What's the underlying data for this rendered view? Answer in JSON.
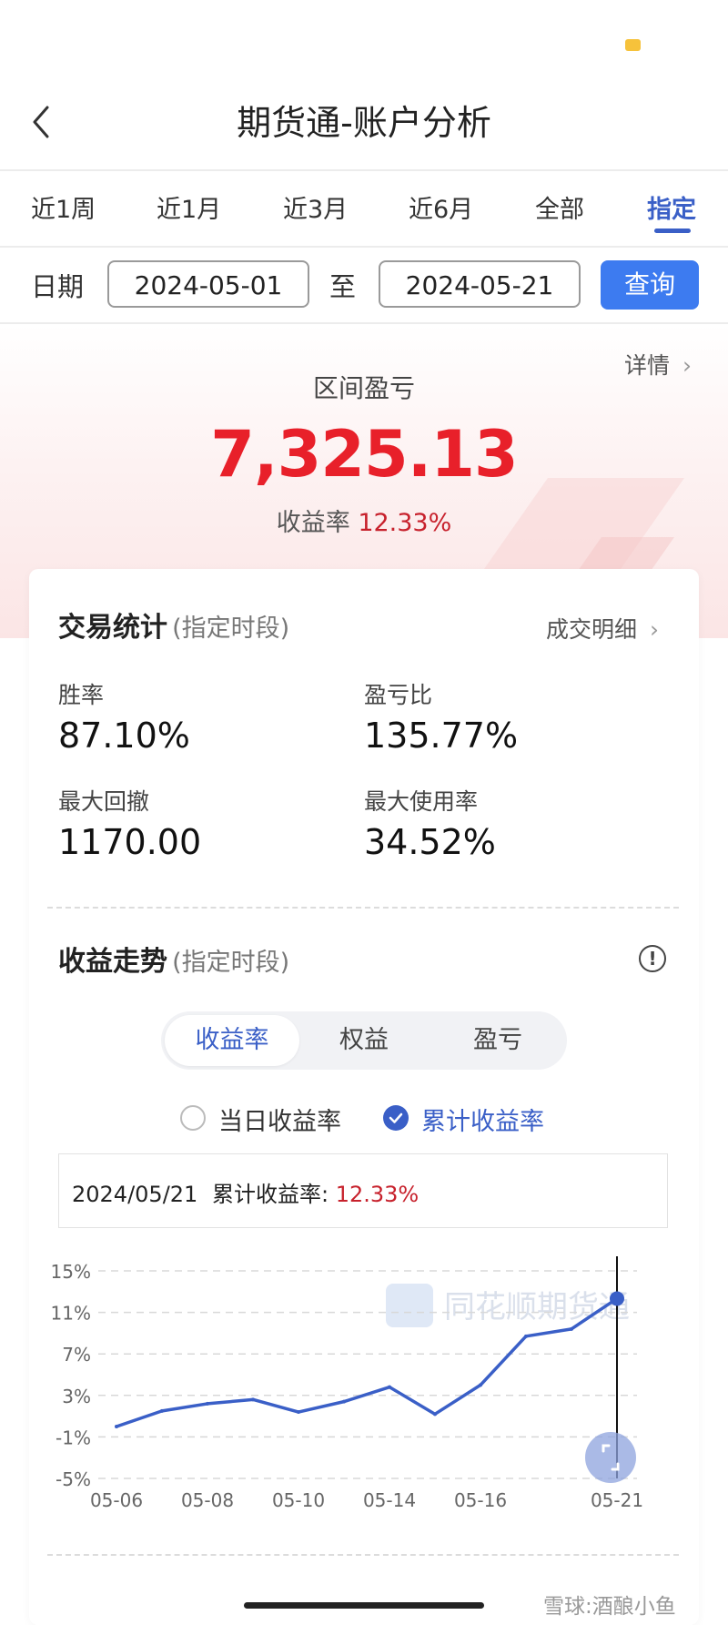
{
  "header": {
    "title": "期货通-账户分析"
  },
  "tabs": [
    {
      "label": "近1周"
    },
    {
      "label": "近1月"
    },
    {
      "label": "近3月"
    },
    {
      "label": "近6月"
    },
    {
      "label": "全部"
    },
    {
      "label": "指定",
      "active": true
    }
  ],
  "date_filter": {
    "label": "日期",
    "start": "2024-05-01",
    "separator": "至",
    "end": "2024-05-21",
    "query_label": "查询"
  },
  "summary": {
    "detail_link": "详情",
    "range_label": "区间盈亏",
    "pnl": "7,325.13",
    "yield_label": "收益率",
    "yield_value": "12.33%"
  },
  "trade_stats": {
    "title": "交易统计",
    "subtitle": "(指定时段)",
    "link": "成交明细",
    "items": [
      {
        "label": "胜率",
        "value": "87.10%"
      },
      {
        "label": "盈亏比",
        "value": "135.77%"
      },
      {
        "label": "最大回撤",
        "value": "1170.00"
      },
      {
        "label": "最大使用率",
        "value": "34.52%"
      }
    ]
  },
  "trend": {
    "title": "收益走势",
    "subtitle": "(指定时段)",
    "segments": [
      {
        "label": "收益率",
        "active": true
      },
      {
        "label": "权益"
      },
      {
        "label": "盈亏"
      }
    ],
    "radios": [
      {
        "label": "当日收益率",
        "checked": false
      },
      {
        "label": "累计收益率",
        "checked": true
      }
    ],
    "tooltip_date": "2024/05/21",
    "tooltip_label": "累计收益率:",
    "tooltip_value": "12.33%"
  },
  "watermark": "同花顺期货通",
  "footer_watermark": "雪球:酒酿小鱼",
  "colors": {
    "accent": "#3a5fc7",
    "profit_red": "#e8202a",
    "query_blue": "#3d7bf0"
  },
  "chart_data": {
    "type": "line",
    "x": [
      "05-06",
      "05-07",
      "05-08",
      "05-09",
      "05-10",
      "05-13",
      "05-14",
      "05-15",
      "05-16",
      "05-17",
      "05-20",
      "05-21"
    ],
    "series": [
      {
        "values": [
          0.0,
          1.5,
          2.2,
          2.6,
          1.4,
          2.4,
          3.8,
          1.2,
          4.0,
          8.7,
          9.4,
          12.33
        ]
      }
    ],
    "x_tick_labels": [
      "05-06",
      "05-08",
      "05-10",
      "05-14",
      "05-16",
      "05-21"
    ],
    "y_ticks": [
      15,
      11,
      7,
      3,
      -1,
      -5
    ],
    "y_tick_labels": [
      "15%",
      "11%",
      "7%",
      "3%",
      "-1%",
      "-5%"
    ],
    "ylim": [
      -5,
      15
    ],
    "grid": true,
    "highlight_x": "05-21"
  }
}
